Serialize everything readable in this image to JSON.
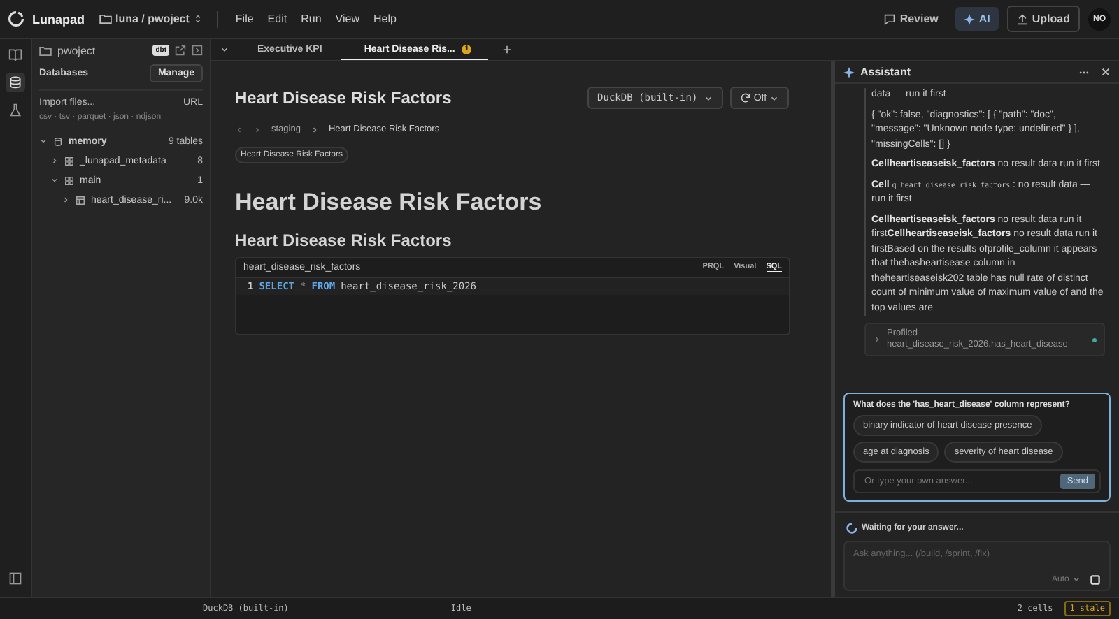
{
  "topbar": {
    "app_name": "Lunapad",
    "project": "luna / pwoject",
    "menu": [
      "File",
      "Edit",
      "Run",
      "View",
      "Help"
    ],
    "actions": [
      {
        "label": "Review",
        "kind": "review",
        "selected": false
      },
      {
        "label": "AI",
        "kind": "ai",
        "selected": true
      },
      {
        "label": "Upload",
        "kind": "upload",
        "selected": false
      }
    ],
    "avatar": "NO"
  },
  "rail": [
    {
      "kind": "book",
      "selected": false
    },
    {
      "kind": "database",
      "selected": true
    },
    {
      "kind": "flask",
      "selected": false
    }
  ],
  "sidebar": {
    "project": "pwoject",
    "badge": "dbt",
    "section": "Databases",
    "manage": "Manage",
    "import": "Import files...",
    "url": "URL",
    "formats": "csv · tsv · parquet · json · ndjson",
    "tree": [
      {
        "name": "memory",
        "kind": "database",
        "count": "9 tables",
        "expanded": true,
        "children": [
          {
            "name": "_lunapad_metadata",
            "kind": "schema",
            "count": "8",
            "expanded": false
          },
          {
            "name": "main",
            "kind": "schema",
            "count": "1",
            "expanded": true,
            "children": [
              {
                "name": "heart_disease_ri...",
                "kind": "table",
                "count": "9.0k",
                "expanded": false
              }
            ]
          }
        ]
      }
    ]
  },
  "tabs": [
    {
      "label": "Executive KPI",
      "selected": false
    },
    {
      "label": "Heart Disease Ris...",
      "selected": true,
      "badge": "1"
    }
  ],
  "doc": {
    "title": "Heart Disease Risk Factors",
    "engine": "DuckDB (built-in)",
    "refresh": "Off",
    "breadcrumb": [
      "staging",
      "Heart Disease Risk Factors"
    ],
    "chip": "Heart Disease Risk Factors",
    "h1": "Heart Disease Risk Factors",
    "h2": "Heart Disease Risk Factors",
    "cell": {
      "name": "heart_disease_risk_factors",
      "modes": [
        {
          "label": "PRQL",
          "selected": false
        },
        {
          "label": "Visual",
          "selected": false
        },
        {
          "label": "SQL",
          "selected": true
        }
      ],
      "line_number": "1",
      "code": [
        {
          "text": "SELECT",
          "kind": "keyword"
        },
        {
          "text": "*",
          "kind": "op"
        },
        {
          "text": "FROM",
          "kind": "keyword"
        },
        {
          "text": "heart_disease_risk_2026",
          "kind": "ident"
        }
      ]
    }
  },
  "assistant": {
    "title": "Assistant",
    "messages": [
      [
        {
          "kind": "text",
          "text": "data — run it first"
        }
      ],
      [
        {
          "kind": "text",
          "text": "{ \"ok\": false, \"diagnostics\": [ { \"path\": \"doc\", \"message\": \"Unknown node type: undefined\" } ], \"missingCells\": [] }"
        }
      ],
      [
        {
          "kind": "text",
          "text": "**Cellheartiseaseisk_factors** no result data run it first"
        }
      ],
      [
        {
          "kind": "text",
          "text": "**Cell** "
        },
        {
          "kind": "code",
          "text": "q_heart_disease_risk_factors"
        },
        {
          "kind": "text",
          "text": " : no result data — run it first"
        }
      ],
      [
        {
          "kind": "text",
          "text": "**Cellheartiseaseisk_factors** no result data run it first**Cellheartiseaseisk_factors** no result data run it firstBased on the results ofprofile_column it appears that thehasheartisease column in theheartiseaseisk202 table has null rate of distinct count of minimum value of maximum value of and the top values are"
        }
      ]
    ],
    "tool": {
      "label": "Profiled",
      "detail": "heart_disease_risk_2026.has_heart_disease"
    },
    "question": {
      "text": "What does the 'has_heart_disease' column represent?",
      "options": [
        "binary indicator of heart disease presence",
        "age at diagnosis",
        "severity of heart disease"
      ],
      "placeholder": "Or type your own answer...",
      "send": "Send"
    },
    "status": "Waiting for your answer...",
    "input_placeholder": "Ask anything... (/build, /sprint, /fix)",
    "mode": "Auto"
  },
  "statusbar": {
    "engine": "DuckDB (built-in)",
    "state": "Idle",
    "cells": "2 cells",
    "stale": "1 stale"
  }
}
